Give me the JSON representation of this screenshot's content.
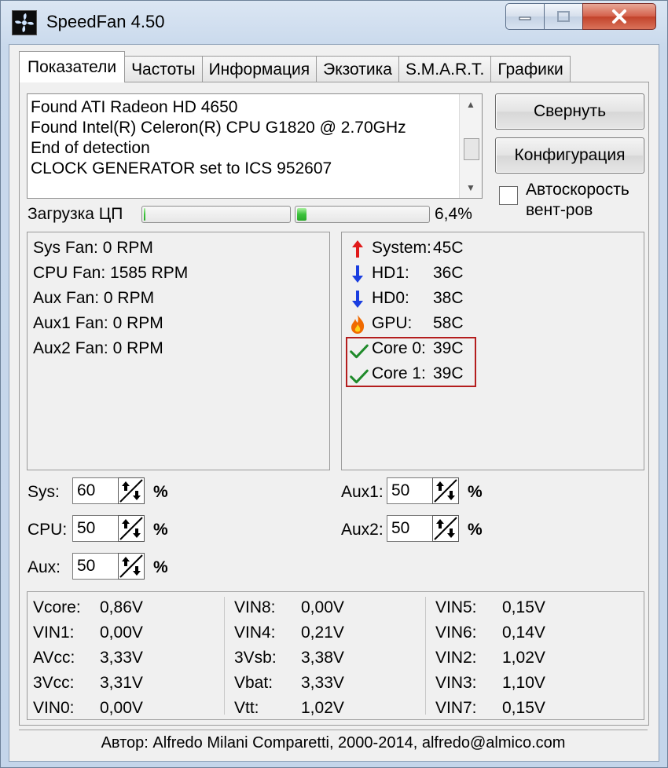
{
  "window": {
    "title": "SpeedFan 4.50",
    "minimize_icon": "minimize-icon",
    "maximize_icon": "maximize-icon",
    "close_icon": "close-icon",
    "app_icon": "speedfan-fan-icon"
  },
  "tabs": [
    {
      "label": "Показатели",
      "active": true
    },
    {
      "label": "Частоты",
      "active": false
    },
    {
      "label": "Информация",
      "active": false
    },
    {
      "label": "Экзотика",
      "active": false
    },
    {
      "label": "S.M.A.R.T.",
      "active": false
    },
    {
      "label": "Графики",
      "active": false
    }
  ],
  "log": {
    "lines": [
      "Found ATI Radeon HD 4650",
      "Found Intel(R) Celeron(R) CPU G1820 @ 2.70GHz",
      "End of detection",
      "CLOCK GENERATOR set to ICS 952607"
    ]
  },
  "buttons": {
    "minimize_label": "Свернуть",
    "config_label": "Конфигурация"
  },
  "autospeed": {
    "line1": "Автоскорость",
    "line2": "вент-ров",
    "checked": false
  },
  "cpu_usage": {
    "label": "Загрузка ЦП",
    "core_loads": [
      0.01,
      0.07
    ],
    "value_text": "6,4%"
  },
  "fans": [
    {
      "name": "Sys Fan:",
      "value": "0 RPM"
    },
    {
      "name": "CPU Fan:",
      "value": "1585 RPM"
    },
    {
      "name": "Aux Fan:",
      "value": "0 RPM"
    },
    {
      "name": "Aux1 Fan:",
      "value": "0 RPM"
    },
    {
      "name": "Aux2 Fan:",
      "value": "0 RPM"
    }
  ],
  "temps": [
    {
      "name": "System:",
      "value": "45C",
      "icon": "arrow-up-icon",
      "color": "#e01a1a"
    },
    {
      "name": "HD1:",
      "value": "36C",
      "icon": "arrow-down-icon",
      "color": "#1a3ee0"
    },
    {
      "name": "HD0:",
      "value": "38C",
      "icon": "arrow-down-icon",
      "color": "#1a3ee0"
    },
    {
      "name": "GPU:",
      "value": "58C",
      "icon": "flame-icon",
      "color": "#f06a00"
    },
    {
      "name": "Core 0:",
      "value": "39C",
      "icon": "checkmark-icon",
      "color": "#1f8a2a"
    },
    {
      "name": "Core 1:",
      "value": "39C",
      "icon": "checkmark-icon",
      "color": "#1f8a2a"
    }
  ],
  "speeds": {
    "sys": {
      "label": "Sys:",
      "value": "60"
    },
    "cpu": {
      "label": "CPU:",
      "value": "50"
    },
    "aux": {
      "label": "Aux:",
      "value": "50"
    },
    "aux1": {
      "label": "Aux1:",
      "value": "50"
    },
    "aux2": {
      "label": "Aux2:",
      "value": "50"
    },
    "unit": "%"
  },
  "voltages": {
    "col1": [
      {
        "name": "Vcore:",
        "value": "0,86V"
      },
      {
        "name": "VIN1:",
        "value": "0,00V"
      },
      {
        "name": "AVcc:",
        "value": "3,33V"
      },
      {
        "name": "3Vcc:",
        "value": "3,31V"
      },
      {
        "name": "VIN0:",
        "value": "0,00V"
      }
    ],
    "col2": [
      {
        "name": "VIN8:",
        "value": "0,00V"
      },
      {
        "name": "VIN4:",
        "value": "0,21V"
      },
      {
        "name": "3Vsb:",
        "value": "3,38V"
      },
      {
        "name": "Vbat:",
        "value": "3,33V"
      },
      {
        "name": "Vtt:",
        "value": "1,02V"
      }
    ],
    "col3": [
      {
        "name": "VIN5:",
        "value": "0,15V"
      },
      {
        "name": "VIN6:",
        "value": "0,14V"
      },
      {
        "name": "VIN2:",
        "value": "1,02V"
      },
      {
        "name": "VIN3:",
        "value": "1,10V"
      },
      {
        "name": "VIN7:",
        "value": "0,15V"
      }
    ]
  },
  "status": {
    "text": "Автор: Alfredo Milani Comparetti, 2000-2014, alfredo@almico.com"
  },
  "highlight_color": "#b41d1d"
}
